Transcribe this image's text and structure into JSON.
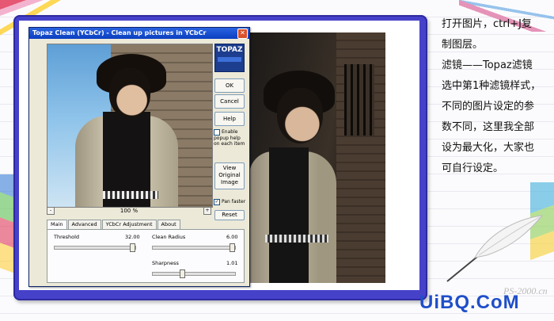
{
  "dialog": {
    "title": "Topaz Clean (YCbCr) - Clean up pictures in YCbCr",
    "close_glyph": "✕",
    "logo_text": "TOPAZ",
    "zoom_text": "100 %",
    "zoom_minus": "-",
    "zoom_plus": "+",
    "buttons": {
      "ok": "OK",
      "cancel": "Cancel",
      "help": "Help",
      "view_original": "View Original Image",
      "reset": "Reset"
    },
    "checkboxes": {
      "popup_help": {
        "label": "Enable popup help on each item",
        "checked": false
      },
      "pan_faster": {
        "label": "Pan faster",
        "checked": true
      }
    },
    "tabs": [
      {
        "label": "Main",
        "active": true
      },
      {
        "label": "Advanced",
        "active": false
      },
      {
        "label": "YCbCr Adjustment",
        "active": false
      },
      {
        "label": "About",
        "active": false
      }
    ],
    "sliders": {
      "threshold": {
        "label": "Threshold",
        "value": "32.00",
        "fraction": 1.0
      },
      "clean_radius": {
        "label": "Clean Radius",
        "value": "6.00",
        "fraction": 1.0
      },
      "sharpness": {
        "label": "Sharpness",
        "value": "1.01",
        "fraction": 0.35
      }
    }
  },
  "instructions": {
    "lines": [
      "打开图片，ctrl+J复",
      "制图层。",
      "滤镜——Topaz滤镜",
      "选中第1种滤镜样式，",
      "不同的图片设定的参",
      "数不同，这里我全部",
      "设为最大化，大家也",
      "可自行设定。"
    ]
  },
  "watermark": {
    "main": "UiBQ.CoM",
    "sub": "PS-2000.cn"
  },
  "colors": {
    "frame": "#4641c9",
    "titlebar": "#0a3fc0",
    "watermark": "#1f4fc9"
  }
}
